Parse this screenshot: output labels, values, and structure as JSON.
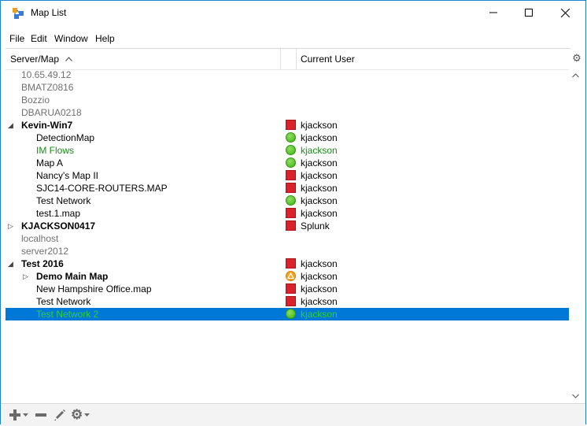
{
  "window": {
    "title": "Map List"
  },
  "menu": [
    "File",
    "Edit",
    "Window",
    "Help"
  ],
  "columns": {
    "server_map": "Server/Map",
    "current_user": "Current User"
  },
  "rows": [
    {
      "name": "10.65.49.12",
      "level": 0,
      "expander": "",
      "bold": false,
      "name_color": "#707070",
      "status": "",
      "user": "",
      "user_color": "#000000"
    },
    {
      "name": "BMATZ0816",
      "level": 0,
      "expander": "",
      "bold": false,
      "name_color": "#707070",
      "status": "",
      "user": "",
      "user_color": "#000000"
    },
    {
      "name": "Bozzio",
      "level": 0,
      "expander": "",
      "bold": false,
      "name_color": "#707070",
      "status": "",
      "user": "",
      "user_color": "#000000"
    },
    {
      "name": "DBARUA0218",
      "level": 0,
      "expander": "",
      "bold": false,
      "name_color": "#707070",
      "status": "",
      "user": "",
      "user_color": "#000000"
    },
    {
      "name": "Kevin-Win7",
      "level": 0,
      "expander": "expanded",
      "bold": true,
      "name_color": "#000000",
      "status": "red",
      "user": "kjackson",
      "user_color": "#000000"
    },
    {
      "name": "DetectionMap",
      "level": 1,
      "expander": "",
      "bold": false,
      "name_color": "#000000",
      "status": "green",
      "user": "kjackson",
      "user_color": "#000000"
    },
    {
      "name": "IM Flows",
      "level": 1,
      "expander": "",
      "bold": false,
      "name_color": "#1a8a1a",
      "status": "green",
      "user": "kjackson",
      "user_color": "#1a8a1a"
    },
    {
      "name": "Map A",
      "level": 1,
      "expander": "",
      "bold": false,
      "name_color": "#000000",
      "status": "green",
      "user": "kjackson",
      "user_color": "#000000"
    },
    {
      "name": "Nancy's Map II",
      "level": 1,
      "expander": "",
      "bold": false,
      "name_color": "#000000",
      "status": "red",
      "user": "kjackson",
      "user_color": "#000000"
    },
    {
      "name": "SJC14-CORE-ROUTERS.MAP",
      "level": 1,
      "expander": "",
      "bold": false,
      "name_color": "#000000",
      "status": "red",
      "user": "kjackson",
      "user_color": "#000000"
    },
    {
      "name": "Test Network",
      "level": 1,
      "expander": "",
      "bold": false,
      "name_color": "#000000",
      "status": "green",
      "user": "kjackson",
      "user_color": "#000000"
    },
    {
      "name": "test.1.map",
      "level": 1,
      "expander": "",
      "bold": false,
      "name_color": "#000000",
      "status": "red",
      "user": "kjackson",
      "user_color": "#000000"
    },
    {
      "name": "KJACKSON0417",
      "level": 0,
      "expander": "collapsed",
      "bold": true,
      "name_color": "#000000",
      "status": "red",
      "user": "Splunk",
      "user_color": "#000000"
    },
    {
      "name": "localhost",
      "level": 0,
      "expander": "",
      "bold": false,
      "name_color": "#707070",
      "status": "",
      "user": "",
      "user_color": "#000000"
    },
    {
      "name": "server2012",
      "level": 0,
      "expander": "",
      "bold": false,
      "name_color": "#707070",
      "status": "",
      "user": "",
      "user_color": "#000000"
    },
    {
      "name": "Test 2016",
      "level": 0,
      "expander": "expanded",
      "bold": true,
      "name_color": "#000000",
      "status": "red",
      "user": "kjackson",
      "user_color": "#000000"
    },
    {
      "name": "Demo Main Map",
      "level": 1,
      "expander": "collapsed",
      "bold": true,
      "name_color": "#000000",
      "status": "warn",
      "user": "kjackson",
      "user_color": "#000000"
    },
    {
      "name": "New Hampshire Office.map",
      "level": 1,
      "expander": "",
      "bold": false,
      "name_color": "#000000",
      "status": "red",
      "user": "kjackson",
      "user_color": "#000000"
    },
    {
      "name": "Test Network",
      "level": 1,
      "expander": "",
      "bold": false,
      "name_color": "#000000",
      "status": "red",
      "user": "kjackson",
      "user_color": "#000000"
    },
    {
      "name": "Test Network 2",
      "level": 1,
      "expander": "",
      "bold": false,
      "name_color": "#2fd12f",
      "status": "green",
      "user": "kjackson",
      "user_color": "#2fd12f",
      "selected": true
    }
  ],
  "colors": {
    "selection": "#0078d7",
    "accent_border": "#1883d7"
  },
  "footer_icons": [
    "add-icon",
    "remove-icon",
    "edit-icon",
    "settings-icon"
  ]
}
